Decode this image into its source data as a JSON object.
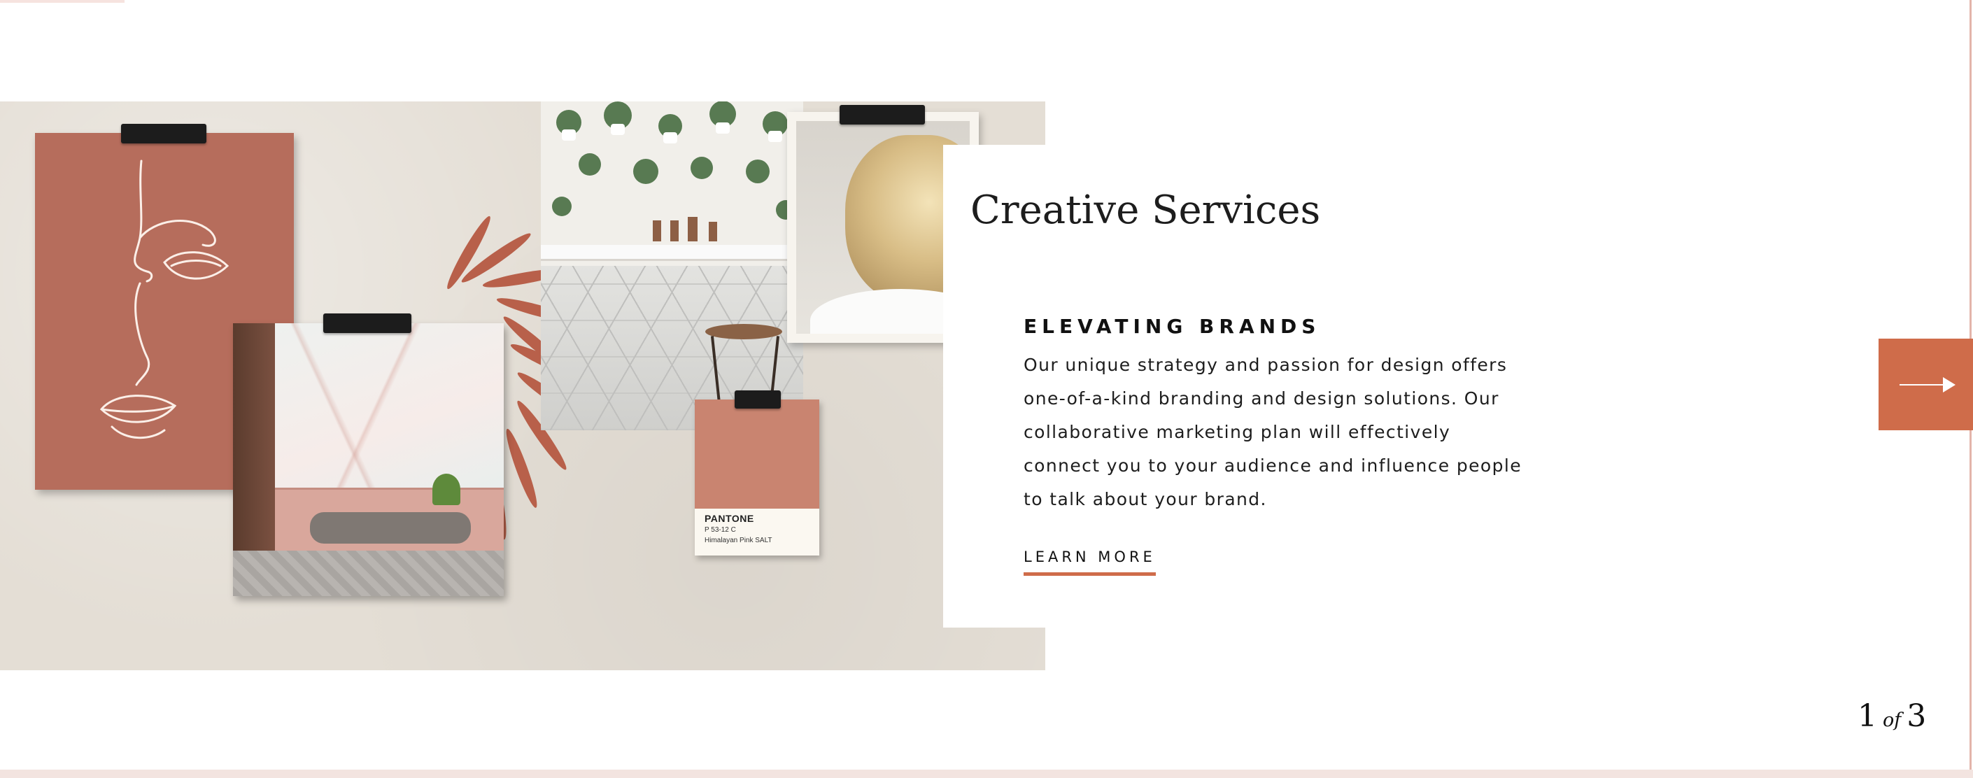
{
  "hero": {
    "title": "Creative Services",
    "eyebrow": "ELEVATING BRANDS",
    "description": "Our unique strategy and passion for design offers one-of-a-kind branding and design solutions. Our collaborative marketing plan will effectively connect you to your audience and influence people to talk about your brand.",
    "cta_label": "LEARN MORE"
  },
  "moodboard": {
    "pantone": {
      "brand": "PANTONE",
      "code": "P 53-12 C",
      "name": "Himalayan Pink SALT"
    }
  },
  "slider": {
    "current": "1",
    "separator": "of",
    "total": "3",
    "next_icon": "arrow-right-icon"
  },
  "colors": {
    "accent": "#cf6c4a",
    "terracotta_card": "#b66d5c",
    "pantone_swatch": "#c98470",
    "background": "#ffffff"
  }
}
